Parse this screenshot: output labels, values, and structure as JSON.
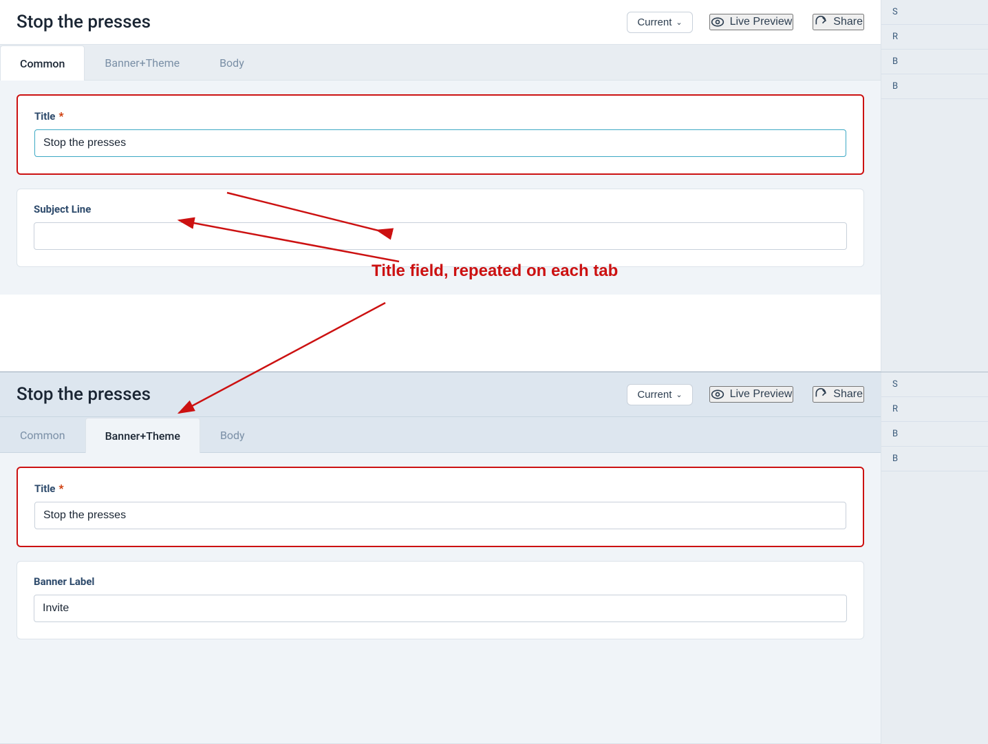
{
  "top_panel": {
    "header": {
      "title": "Stop the presses",
      "version_label": "Current",
      "live_preview_label": "Live Preview",
      "share_label": "Share"
    },
    "tabs": [
      {
        "id": "common",
        "label": "Common",
        "active": true
      },
      {
        "id": "banner_theme",
        "label": "Banner+Theme",
        "active": false
      },
      {
        "id": "body",
        "label": "Body",
        "active": false
      }
    ],
    "title_section": {
      "label": "Title",
      "required": "*",
      "value": "Stop the presses",
      "placeholder": ""
    },
    "subject_section": {
      "label": "Subject Line",
      "value": "",
      "placeholder": ""
    }
  },
  "bottom_panel": {
    "header": {
      "title": "Stop the presses",
      "version_label": "Current",
      "live_preview_label": "Live Preview",
      "share_label": "Share"
    },
    "tabs": [
      {
        "id": "common",
        "label": "Common",
        "active": false
      },
      {
        "id": "banner_theme",
        "label": "Banner+Theme",
        "active": true
      },
      {
        "id": "body",
        "label": "Body",
        "active": false
      }
    ],
    "title_section": {
      "label": "Title",
      "required": "*",
      "value": "Stop the presses",
      "placeholder": ""
    },
    "banner_label_section": {
      "label": "Banner Label",
      "value": "Invite",
      "placeholder": ""
    }
  },
  "annotation": {
    "text": "Title field, repeated on each tab"
  },
  "right_strip_top": {
    "items": [
      "S",
      "R",
      "B",
      "B"
    ]
  },
  "right_strip_bottom": {
    "items": [
      "S",
      "R",
      "B",
      "B"
    ]
  }
}
